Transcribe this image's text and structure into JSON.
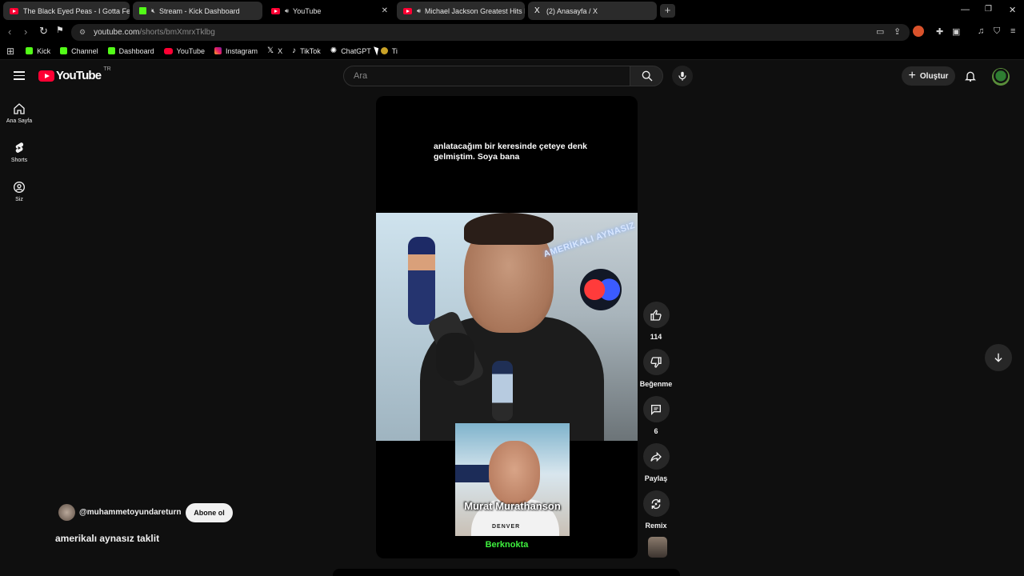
{
  "browser": {
    "tabs": [
      {
        "title": "The Black Eyed Peas - I Gotta Feeling",
        "icon": "youtube-icon"
      },
      {
        "title": "Stream - Kick Dashboard",
        "icon": "kick-icon"
      },
      {
        "title": "YouTube",
        "icon": "youtube-icon"
      },
      {
        "title": "Michael Jackson Greatest Hits Fu",
        "icon": "youtube-icon"
      },
      {
        "title": "(2) Anasayfa / X",
        "icon": "x-icon"
      }
    ],
    "new_tab_label": "+",
    "url_host": "youtube.com",
    "url_path": "/shorts/bmXmrxTklbg"
  },
  "bookmarks": [
    {
      "label": "Kick",
      "icon": "kick-icon"
    },
    {
      "label": "Channel",
      "icon": "kick-icon"
    },
    {
      "label": "Dashboard",
      "icon": "kick-icon"
    },
    {
      "label": "YouTube",
      "icon": "youtube-icon"
    },
    {
      "label": "Instagram",
      "icon": "instagram-icon"
    },
    {
      "label": "X",
      "icon": "x-icon"
    },
    {
      "label": "TikTok",
      "icon": "tiktok-icon"
    },
    {
      "label": "ChatGPT",
      "icon": "chatgpt-icon"
    },
    {
      "label": "Ti",
      "icon": "bookmark-icon"
    }
  ],
  "youtube": {
    "logo_text": "YouTube",
    "country_code": "TR",
    "search_placeholder": "Ara",
    "create_label": "Oluştur",
    "guide": [
      {
        "label": "Ana Sayfa",
        "icon": "home-icon"
      },
      {
        "label": "Shorts",
        "icon": "shorts-icon"
      },
      {
        "label": "Siz",
        "icon": "you-icon"
      }
    ]
  },
  "short": {
    "caption": "anlatacağım bir keresinde çeteye denk gelmiştim. Soya bana",
    "neon_sign": "AMERİKALI AYNASIZ",
    "inset_name": "Murat Murathanson",
    "inset_shirt": "DENVER",
    "overlay_credit": "Berknokta",
    "channel_handle": "@muhammetoyundareturn",
    "subscribe_label": "Abone ol",
    "title": "amerikalı aynasız taklit"
  },
  "actions": {
    "like_count": "114",
    "dislike_label": "Beğenme",
    "comment_count": "6",
    "share_label": "Paylaş",
    "remix_label": "Remix"
  },
  "colors": {
    "youtube_red": "#ff0033",
    "kick_green": "#53fc18",
    "credit_green": "#3ef03e",
    "background": "#0f0f0f"
  }
}
